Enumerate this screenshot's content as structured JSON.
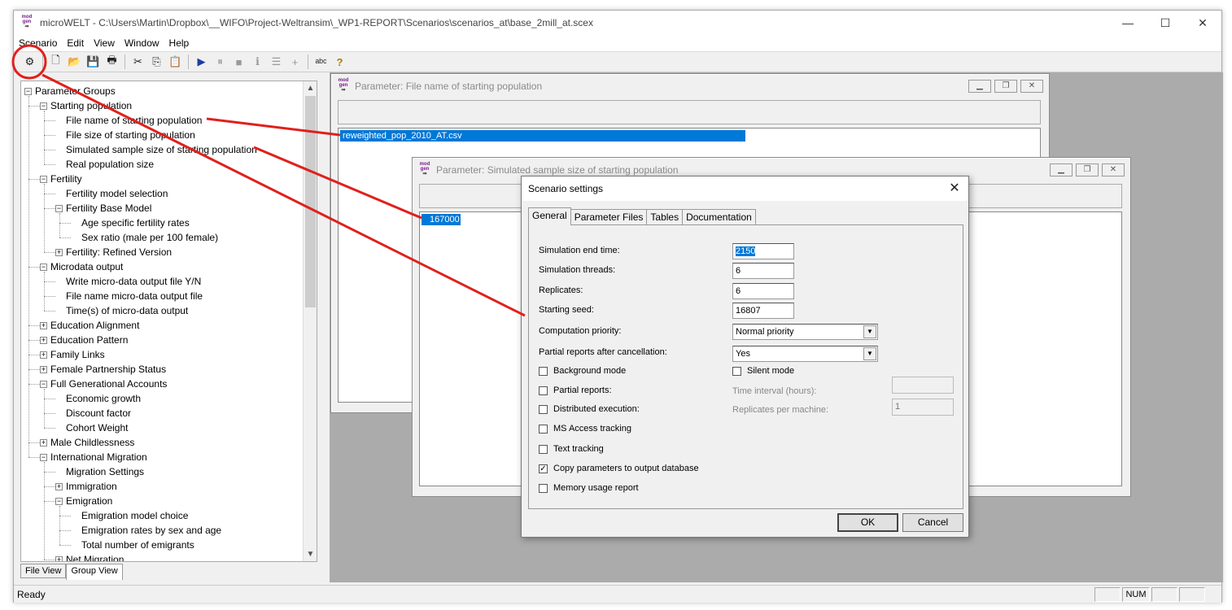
{
  "window": {
    "title": "microWELT - C:\\Users\\Martin\\Dropbox\\__WIFO\\Project-Weltransim\\_WP1-REPORT\\Scenarios\\scenarios_at\\base_2mill_at.scex",
    "min": "—",
    "max": "☐",
    "close": "✕"
  },
  "logo": {
    "line1": "mod",
    "line2": "gen",
    "line3": "⇛"
  },
  "menu": [
    "Scenario",
    "Edit",
    "View",
    "Window",
    "Help"
  ],
  "toolbar": {
    "settings": "⚙",
    "new": "🗋",
    "open": "📂",
    "save": "💾",
    "print": "🖶",
    "cut": "✂",
    "copy": "⎘",
    "paste": "📋",
    "run": "▶",
    "pause": "⏸",
    "stop": "■",
    "info": "ℹ",
    "log": "☰",
    "add": "+",
    "abc": "ᵃᵇᶜ",
    "help": "?"
  },
  "tree": [
    {
      "label": "Parameter Groups",
      "level": 0,
      "toggle": "−"
    },
    {
      "label": "Starting population",
      "level": 1,
      "toggle": "−"
    },
    {
      "label": "File name of starting population",
      "level": 2
    },
    {
      "label": "File size of starting population",
      "level": 2
    },
    {
      "label": "Simulated sample size of starting population",
      "level": 2
    },
    {
      "label": "Real population size",
      "level": 2
    },
    {
      "label": "Fertility",
      "level": 1,
      "toggle": "−"
    },
    {
      "label": "Fertility model selection",
      "level": 2
    },
    {
      "label": "Fertility Base Model",
      "level": 2,
      "toggle": "−"
    },
    {
      "label": "Age specific fertility rates",
      "level": 3
    },
    {
      "label": "Sex ratio (male per 100 female)",
      "level": 3
    },
    {
      "label": "Fertility: Refined Version",
      "level": 2,
      "toggle": "+"
    },
    {
      "label": "Microdata output",
      "level": 1,
      "toggle": "−"
    },
    {
      "label": "Write micro-data output file Y/N",
      "level": 2
    },
    {
      "label": "File name micro-data output file",
      "level": 2
    },
    {
      "label": "Time(s) of micro-data output",
      "level": 2
    },
    {
      "label": "Education Alignment",
      "level": 1,
      "toggle": "+"
    },
    {
      "label": "Education Pattern",
      "level": 1,
      "toggle": "+"
    },
    {
      "label": "Family Links",
      "level": 1,
      "toggle": "+"
    },
    {
      "label": "Female Partnership Status",
      "level": 1,
      "toggle": "+"
    },
    {
      "label": "Full Generational Accounts",
      "level": 1,
      "toggle": "−"
    },
    {
      "label": "Economic growth",
      "level": 2
    },
    {
      "label": "Discount factor",
      "level": 2
    },
    {
      "label": "Cohort Weight",
      "level": 2
    },
    {
      "label": "Male Childlessness",
      "level": 1,
      "toggle": "+"
    },
    {
      "label": "International Migration",
      "level": 1,
      "toggle": "−"
    },
    {
      "label": "Migration Settings",
      "level": 2
    },
    {
      "label": "Immigration",
      "level": 2,
      "toggle": "+"
    },
    {
      "label": "Emigration",
      "level": 2,
      "toggle": "−"
    },
    {
      "label": "Emigration model choice",
      "level": 3
    },
    {
      "label": "Emigration rates by sex and age",
      "level": 3
    },
    {
      "label": "Total number of emigrants",
      "level": 3
    },
    {
      "label": "Net Migration",
      "level": 2,
      "toggle": "+"
    }
  ],
  "bottom_tabs": {
    "file_view": "File View",
    "group_view": "Group View"
  },
  "status": {
    "text": "Ready",
    "num": "NUM"
  },
  "child1": {
    "title": "Parameter: File name of starting population",
    "value": "reweighted_pop_2010_AT.csv"
  },
  "child2": {
    "title": "Parameter: Simulated sample size of starting population",
    "value": "167000"
  },
  "mdi_buttons": {
    "min": "▁",
    "restore": "❐",
    "close": "✕"
  },
  "dialog": {
    "title": "Scenario settings",
    "close": "✕",
    "tabs": [
      "General",
      "Parameter Files",
      "Tables",
      "Documentation"
    ],
    "fields": {
      "end_time_label": "Simulation end time:",
      "end_time": "2150",
      "threads_label": "Simulation threads:",
      "threads": "6",
      "replicates_label": "Replicates:",
      "replicates": "6",
      "seed_label": "Starting seed:",
      "seed": "16807",
      "priority_label": "Computation priority:",
      "priority": "Normal priority",
      "partial_cancel_label": "Partial reports after cancellation:",
      "partial_cancel": "Yes",
      "time_interval_label": "Time interval (hours):",
      "time_interval": "",
      "rep_per_machine_label": "Replicates per machine:",
      "rep_per_machine": "1"
    },
    "checks": {
      "background": "Background mode",
      "silent": "Silent mode",
      "partial": "Partial reports:",
      "distributed": "Distributed execution:",
      "ms_access": "MS Access tracking",
      "text_tracking": "Text tracking",
      "copy_params": "Copy parameters to output database",
      "memory": "Memory usage report",
      "check_mark": "✓"
    },
    "ok": "OK",
    "cancel": "Cancel",
    "dropdown_arrow": "▼"
  }
}
